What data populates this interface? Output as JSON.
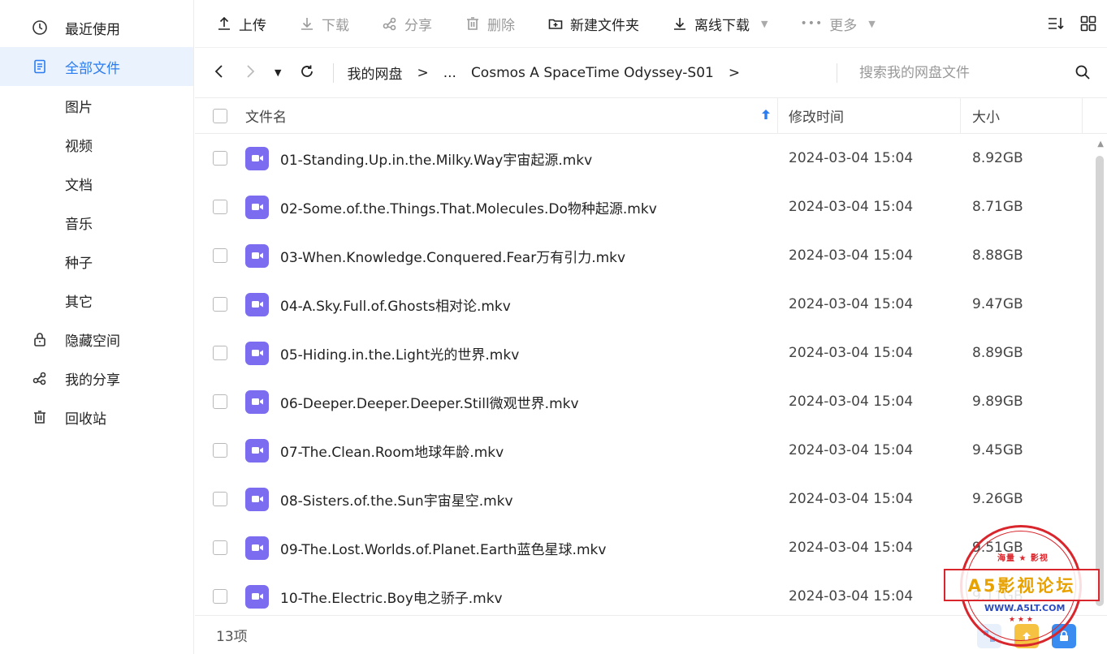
{
  "sidebar": {
    "items": [
      {
        "label": "最近使用",
        "icon": "clock-icon",
        "active": false
      },
      {
        "label": "全部文件",
        "icon": "document-icon",
        "active": true
      },
      {
        "label": "图片",
        "icon": "",
        "active": false
      },
      {
        "label": "视频",
        "icon": "",
        "active": false
      },
      {
        "label": "文档",
        "icon": "",
        "active": false
      },
      {
        "label": "音乐",
        "icon": "",
        "active": false
      },
      {
        "label": "种子",
        "icon": "",
        "active": false
      },
      {
        "label": "其它",
        "icon": "",
        "active": false
      },
      {
        "label": "隐藏空间",
        "icon": "lock-icon",
        "active": false
      },
      {
        "label": "我的分享",
        "icon": "share-icon",
        "active": false
      },
      {
        "label": "回收站",
        "icon": "trash-icon",
        "active": false
      }
    ]
  },
  "toolbar": {
    "upload": "上传",
    "download": "下载",
    "share": "分享",
    "delete": "删除",
    "new_folder": "新建文件夹",
    "offline_download": "离线下载",
    "more": "更多"
  },
  "addressbar": {
    "crumb_root": "我的网盘",
    "crumb_sep1": ">",
    "crumb_ellipsis": "...",
    "crumb_current": "Cosmos A SpaceTime Odyssey-S01",
    "crumb_sep2": ">",
    "search_placeholder": "搜索我的网盘文件"
  },
  "table": {
    "headers": {
      "name": "文件名",
      "time": "修改时间",
      "size": "大小"
    },
    "rows": [
      {
        "name": "01-Standing.Up.in.the.Milky.Way宇宙起源.mkv",
        "time": "2024-03-04 15:04",
        "size": "8.92GB"
      },
      {
        "name": "02-Some.of.the.Things.That.Molecules.Do物种起源.mkv",
        "time": "2024-03-04 15:04",
        "size": "8.71GB"
      },
      {
        "name": "03-When.Knowledge.Conquered.Fear万有引力.mkv",
        "time": "2024-03-04 15:04",
        "size": "8.88GB"
      },
      {
        "name": "04-A.Sky.Full.of.Ghosts相对论.mkv",
        "time": "2024-03-04 15:04",
        "size": "9.47GB"
      },
      {
        "name": "05-Hiding.in.the.Light光的世界.mkv",
        "time": "2024-03-04 15:04",
        "size": "8.89GB"
      },
      {
        "name": "06-Deeper.Deeper.Deeper.Still微观世界.mkv",
        "time": "2024-03-04 15:04",
        "size": "9.89GB"
      },
      {
        "name": "07-The.Clean.Room地球年龄.mkv",
        "time": "2024-03-04 15:04",
        "size": "9.45GB"
      },
      {
        "name": "08-Sisters.of.the.Sun宇宙星空.mkv",
        "time": "2024-03-04 15:04",
        "size": "9.26GB"
      },
      {
        "name": "09-The.Lost.Worlds.of.Planet.Earth蓝色星球.mkv",
        "time": "2024-03-04 15:04",
        "size": "9.51GB"
      },
      {
        "name": "10-The.Electric.Boy电之骄子.mkv",
        "time": "2024-03-04 15:04",
        "size": "9.11GB"
      }
    ]
  },
  "footer": {
    "count": "13项"
  },
  "watermark": {
    "top_text": "海量 ★ 影视",
    "banner": "A5影视论坛",
    "url": "WWW.A5LT.COM",
    "stars": "★ ★ ★"
  },
  "colors": {
    "accent": "#2b7cf0",
    "video_icon": "#7b6cf0",
    "stamp_red": "#d9262c"
  }
}
